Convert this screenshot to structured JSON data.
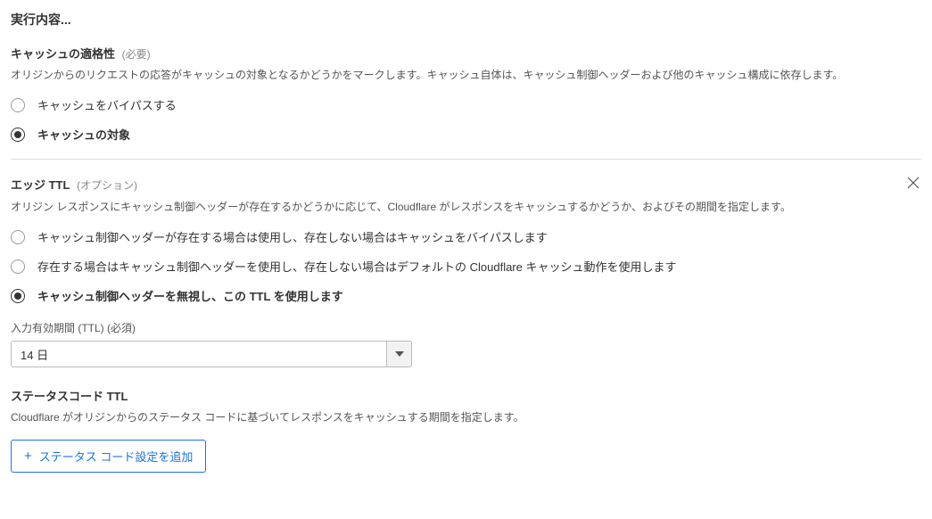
{
  "page_title": "実行内容...",
  "cache_eligibility": {
    "title": "キャッシュの適格性",
    "qualifier": "(必要)",
    "description": "オリジンからのリクエストの応答がキャッシュの対象となるかどうかをマークします。キャッシュ自体は、キャッシュ制御ヘッダーおよび他のキャッシュ構成に依存します。",
    "options": {
      "bypass": "キャッシュをバイパスする",
      "eligible": "キャッシュの対象"
    }
  },
  "edge_ttl": {
    "title": "エッジ TTL",
    "qualifier": "(オプション)",
    "description": "オリジン レスポンスにキャッシュ制御ヘッダーが存在するかどうかに応じて、Cloudflare がレスポンスをキャッシュするかどうか、およびその期間を指定します。",
    "options": {
      "use_header_else_bypass": "キャッシュ制御ヘッダーが存在する場合は使用し、存在しない場合はキャッシュをバイパスします",
      "use_header_else_default": "存在する場合はキャッシュ制御ヘッダーを使用し、存在しない場合はデフォルトの Cloudflare キャッシュ動作を使用します",
      "ignore_header_use_ttl": "キャッシュ制御ヘッダーを無視し、この TTL を使用します"
    },
    "ttl_field": {
      "label": "入力有効期間 (TTL) (必須)",
      "value": "14 日"
    }
  },
  "status_ttl": {
    "title": "ステータスコード TTL",
    "description": "Cloudflare がオリジンからのステータス コードに基づいてレスポンスをキャッシュする期間を指定します。",
    "add_button": "ステータス コード設定を追加"
  }
}
